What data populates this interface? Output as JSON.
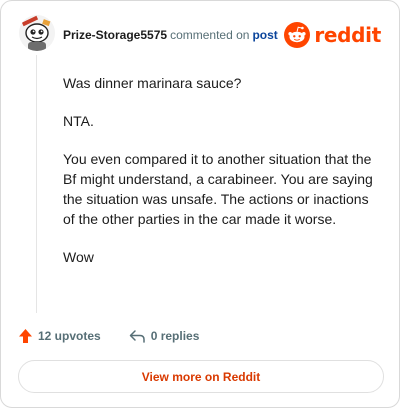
{
  "header": {
    "username": "Prize-Storage5575",
    "action": "commented on",
    "post_link": "post",
    "brand": "reddit"
  },
  "comment": {
    "paragraphs": [
      "Was dinner marinara sauce?",
      "NTA.",
      "You even compared it to another situation that the Bf might understand, a carabineer. You are saying the situation was unsafe. The actions or inactions of the other parties in the car made it worse.",
      "Wow"
    ]
  },
  "stats": {
    "upvotes": "12 upvotes",
    "replies": "0 replies"
  },
  "footer": {
    "view_more": "View more on Reddit"
  },
  "colors": {
    "brand": "#ff4500",
    "link": "#0a449b",
    "muted": "#576f76",
    "cta": "#d93900"
  },
  "icons": {
    "avatar": "snoo-avatar",
    "brand": "reddit-logo-icon",
    "upvote": "upvote-arrow-icon",
    "reply": "reply-arrow-icon"
  }
}
